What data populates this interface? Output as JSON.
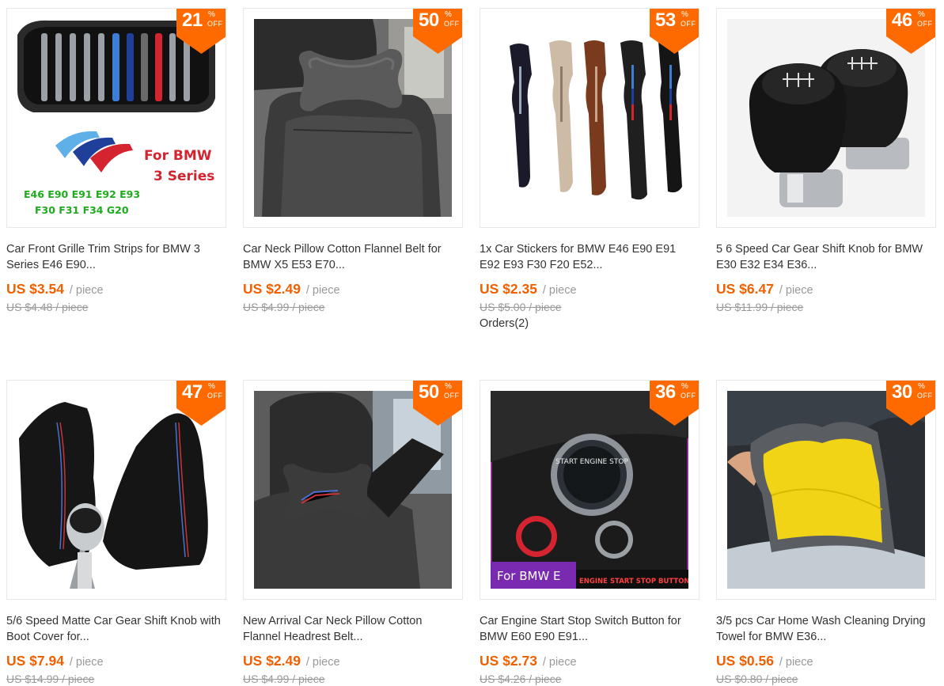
{
  "badge": {
    "percent_symbol": "%",
    "off_label": "OFF"
  },
  "unit_label": "/ piece",
  "old_unit_label": "/ piece",
  "products": [
    {
      "title": "Car Front Grille Trim Strips for BMW 3 Series E46 E90...",
      "price": "US $3.54",
      "old_price": "US $4.48",
      "discount": "21",
      "orders": "",
      "image": "grille-trim-strips",
      "image_text": {
        "line1": "For BMW",
        "line2": "3 Series",
        "models1": "E46 E90 E91 E92 E93",
        "models2": "F30 F31 F34 G20"
      }
    },
    {
      "title": "Car Neck Pillow Cotton Flannel Belt for BMW X5 E53 E70...",
      "price": "US $2.49",
      "old_price": "US $4.99",
      "discount": "50",
      "orders": "",
      "image": "neck-pillow-grey"
    },
    {
      "title": "1x Car Stickers for BMW E46 E90 E91 E92 E93 F30 F20 E52...",
      "price": "US $2.35",
      "old_price": "US $5.00",
      "discount": "53",
      "orders": "Orders(2)",
      "image": "seat-gap-fillers"
    },
    {
      "title": "5 6 Speed Car Gear Shift Knob for BMW E30 E32 E34 E36...",
      "price": "US $6.47",
      "old_price": "US $11.99",
      "discount": "46",
      "orders": "",
      "image": "gear-knobs"
    },
    {
      "title": "5/6 Speed Matte Car Gear Shift Knob with Boot Cover for...",
      "price": "US $7.94",
      "old_price": "US $14.99",
      "discount": "47",
      "orders": "",
      "image": "gear-boot-covers"
    },
    {
      "title": "New Arrival Car Neck Pillow Cotton Flannel Headrest Belt...",
      "price": "US $2.49",
      "old_price": "US $4.99",
      "discount": "50",
      "orders": "",
      "image": "neck-pillow-performance"
    },
    {
      "title": "Car Engine Start Stop Switch Button for BMW E60 E90 E91...",
      "price": "US $2.73",
      "old_price": "US $4.26",
      "discount": "36",
      "orders": "",
      "image": "start-stop-button",
      "image_text": {
        "caption_left": "For BMW E",
        "caption_right": "ENGINE START STOP BUTTON",
        "button": "START ENGINE STOP"
      }
    },
    {
      "title": "3/5 pcs Car Home Wash Cleaning Drying Towel for BMW E36...",
      "price": "US $0.56",
      "old_price": "US $0.80",
      "discount": "30",
      "orders": "",
      "image": "drying-towel"
    }
  ],
  "colors": {
    "accent": "#f06000",
    "badge": "#ff6a00",
    "text": "#333333",
    "muted": "#999999"
  }
}
